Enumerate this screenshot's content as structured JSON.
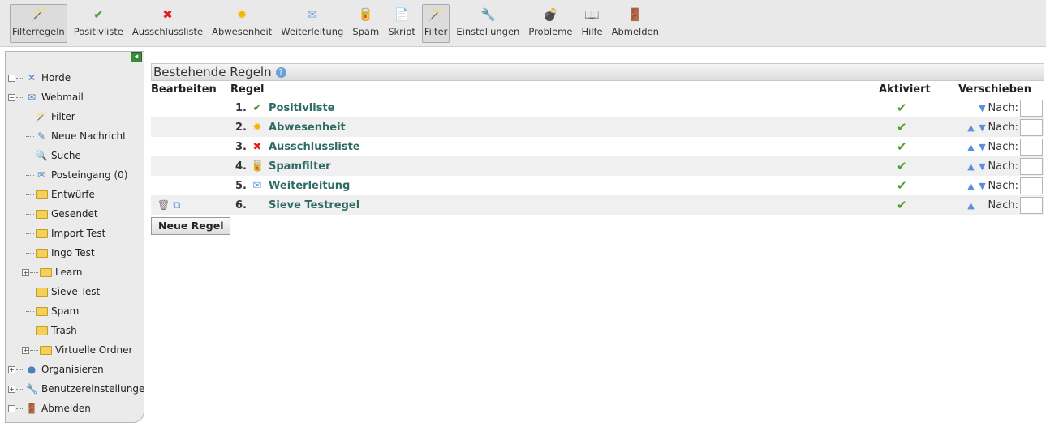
{
  "toolbar": {
    "items": [
      {
        "label": "Filterregeln",
        "icon": "wand-icon",
        "glyph": "🪄",
        "color": "#c8a000",
        "active": true
      },
      {
        "label": "Positivliste",
        "icon": "checkmark-icon",
        "glyph": "✔",
        "color": "#4a9f2c"
      },
      {
        "label": "Ausschlussliste",
        "icon": "red-x-icon",
        "glyph": "✖",
        "color": "#e02020"
      },
      {
        "label": "Abwesenheit",
        "icon": "sun-icon",
        "glyph": "✹",
        "color": "#f2b800"
      },
      {
        "label": "Weiterleitung",
        "icon": "forward-mail-icon",
        "glyph": "✉",
        "color": "#6a9ed8"
      },
      {
        "label": "Spam",
        "icon": "spam-can-icon",
        "glyph": "🥫",
        "color": "#777"
      },
      {
        "label": "Skript",
        "icon": "script-icon",
        "glyph": "📄",
        "color": "#5b8edb"
      },
      {
        "label": "Filter",
        "icon": "wand-icon",
        "glyph": "🪄",
        "color": "#c8a000",
        "active": true
      },
      {
        "label": "Einstellungen",
        "icon": "wrench-icon",
        "glyph": "🔧",
        "color": "#7a9cc8"
      },
      {
        "label": "Probleme",
        "icon": "bomb-icon",
        "glyph": "💣",
        "color": "#222"
      },
      {
        "label": "Hilfe",
        "icon": "book-icon",
        "glyph": "📖",
        "color": "#3b6eb8"
      },
      {
        "label": "Abmelden",
        "icon": "exit-door-icon",
        "glyph": "🚪",
        "color": "#3a8a3a"
      }
    ]
  },
  "sidebar": {
    "tree": [
      {
        "label": "Horde",
        "icon": "horde-icon",
        "glyph": "✕",
        "expander": "□",
        "depth": 0
      },
      {
        "label": "Webmail",
        "icon": "webmail-icon",
        "glyph": "✉",
        "expander": "⊟",
        "depth": 0
      },
      {
        "label": "Filter",
        "icon": "wand-icon",
        "glyph": "🪄",
        "depth": 1
      },
      {
        "label": "Neue Nachricht",
        "icon": "compose-icon",
        "glyph": "✎",
        "depth": 1
      },
      {
        "label": "Suche",
        "icon": "search-icon",
        "glyph": "🔍",
        "depth": 1
      },
      {
        "label": "Posteingang (0)",
        "icon": "inbox-icon",
        "glyph": "✉",
        "depth": 1
      },
      {
        "label": "Entwürfe",
        "icon": "drafts-folder-icon",
        "glyph": "folder",
        "depth": 1
      },
      {
        "label": "Gesendet",
        "icon": "sent-folder-icon",
        "glyph": "folder",
        "depth": 1
      },
      {
        "label": "Import Test",
        "icon": "folder-icon",
        "glyph": "folder",
        "depth": 1
      },
      {
        "label": "Ingo Test",
        "icon": "folder-icon",
        "glyph": "folder",
        "depth": 1
      },
      {
        "label": "Learn",
        "icon": "folder-icon",
        "glyph": "folder",
        "expander": "⊞",
        "depth": 1
      },
      {
        "label": "Sieve Test",
        "icon": "folder-icon",
        "glyph": "folder",
        "depth": 1
      },
      {
        "label": "Spam",
        "icon": "spam-folder-icon",
        "glyph": "folder",
        "depth": 1
      },
      {
        "label": "Trash",
        "icon": "trash-folder-icon",
        "glyph": "folder",
        "depth": 1
      },
      {
        "label": "Virtuelle Ordner",
        "icon": "folder-icon",
        "glyph": "folder",
        "expander": "⊞",
        "depth": 1
      },
      {
        "label": "Organisieren",
        "icon": "organize-icon",
        "glyph": "●",
        "expander": "⊞",
        "depth": 0
      },
      {
        "label": "Benutzereinstellungen",
        "icon": "wrench-icon",
        "glyph": "🔧",
        "expander": "⊞",
        "depth": 0
      },
      {
        "label": "Abmelden",
        "icon": "exit-door-icon",
        "glyph": "🚪",
        "expander": "□",
        "depth": 0
      }
    ]
  },
  "main": {
    "title": "Bestehende Regeln",
    "help_glyph": "?",
    "columns": {
      "edit": "Bearbeiten",
      "rule": "Regel",
      "enabled": "Aktiviert",
      "move": "Verschieben"
    },
    "move_label": "Nach:",
    "rules": [
      {
        "num": "1.",
        "name": "Positivliste",
        "icon": "checkmark-icon",
        "glyph": "✔",
        "color": "#4a9f2c",
        "up": false,
        "down": true,
        "edit": false
      },
      {
        "num": "2.",
        "name": "Abwesenheit",
        "icon": "sun-icon",
        "glyph": "✹",
        "color": "#f2b800",
        "up": true,
        "down": true,
        "edit": false
      },
      {
        "num": "3.",
        "name": "Ausschlussliste",
        "icon": "red-x-icon",
        "glyph": "✖",
        "color": "#e02020",
        "up": true,
        "down": true,
        "edit": false
      },
      {
        "num": "4.",
        "name": "Spamfilter",
        "icon": "spam-can-icon",
        "glyph": "🥫",
        "color": "#777",
        "up": true,
        "down": true,
        "edit": false
      },
      {
        "num": "5.",
        "name": "Weiterleitung",
        "icon": "forward-mail-icon",
        "glyph": "✉",
        "color": "#6a9ed8",
        "up": true,
        "down": true,
        "edit": false
      },
      {
        "num": "6.",
        "name": "Sieve Testregel",
        "icon": "",
        "glyph": "",
        "color": "#333",
        "up": true,
        "down": false,
        "edit": true
      }
    ],
    "check_glyph": "✔",
    "up_glyph": "▲",
    "down_glyph": "▼",
    "delete_glyph": "🗑",
    "copy_glyph": "⧉",
    "new_rule_label": "Neue Regel"
  },
  "colors": {
    "link": "#2e6b63",
    "check": "#4a9f2c",
    "arrow": "#5b8edb"
  }
}
